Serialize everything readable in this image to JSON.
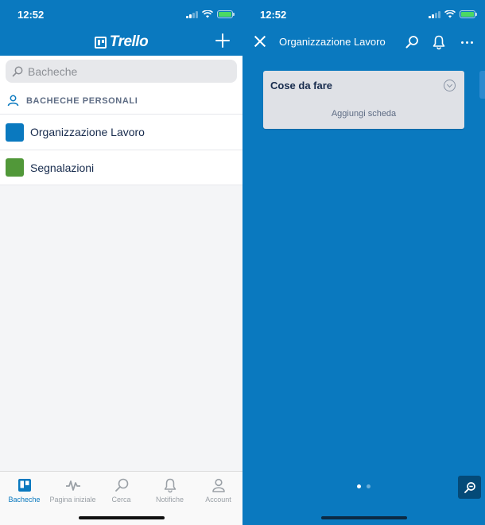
{
  "left_screen": {
    "status_bar": {
      "time": "12:52"
    },
    "header": {
      "logo_text": "Trello"
    },
    "search": {
      "placeholder": "Bacheche"
    },
    "section": {
      "title": "BACHECHE PERSONALI"
    },
    "boards": [
      {
        "name": "Organizzazione Lavoro",
        "color": "#0a79bf"
      },
      {
        "name": "Segnalazioni",
        "color": "#519839"
      }
    ],
    "tabbar": {
      "tabs": [
        {
          "label": "Bacheche",
          "icon": "boards-icon",
          "active": true
        },
        {
          "label": "Pagina iniziale",
          "icon": "activity-icon",
          "active": false
        },
        {
          "label": "Cerca",
          "icon": "search-icon",
          "active": false
        },
        {
          "label": "Notifiche",
          "icon": "bell-icon",
          "active": false
        },
        {
          "label": "Account",
          "icon": "person-icon",
          "active": false
        }
      ]
    }
  },
  "right_screen": {
    "status_bar": {
      "time": "12:52"
    },
    "nav": {
      "title": "Organizzazione Lavoro"
    },
    "list": {
      "title": "Cose da fare",
      "add_card_label": "Aggiungi scheda"
    },
    "pager": {
      "pages": 2,
      "current": 1
    }
  },
  "colors": {
    "trello_blue": "#0a79bf",
    "board_green": "#519839",
    "battery_green": "#4cd964"
  }
}
